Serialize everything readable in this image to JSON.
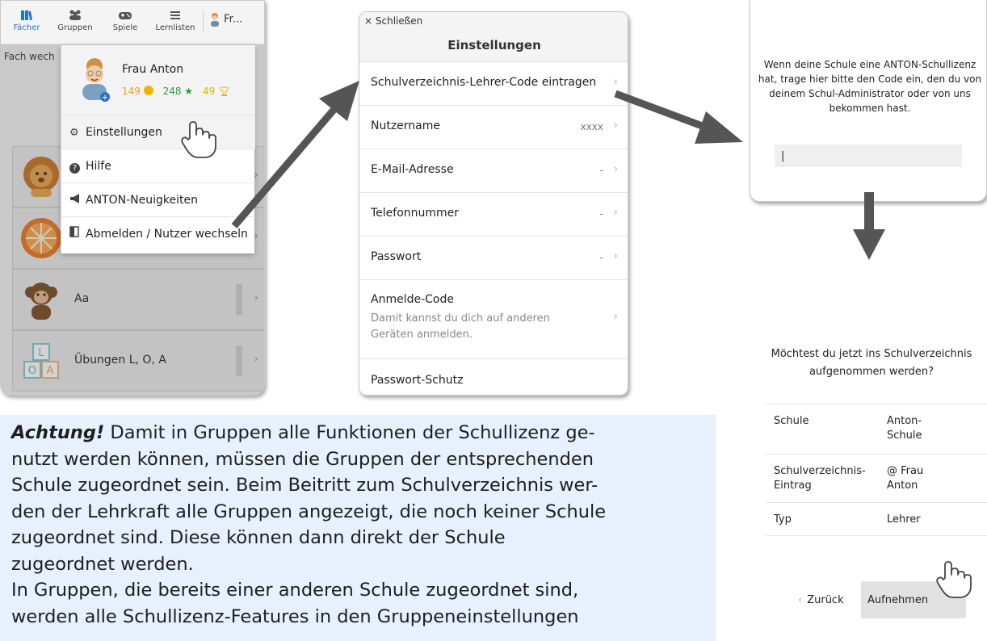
{
  "panel1": {
    "tabs": [
      {
        "label": "Fächer",
        "icon": "books-icon"
      },
      {
        "label": "Gruppen",
        "icon": "group-icon"
      },
      {
        "label": "Spiele",
        "icon": "gamepad-icon"
      },
      {
        "label": "Lernlisten",
        "icon": "list-icon"
      }
    ],
    "user_tab": "Fr...",
    "behind_text": "Fach wech",
    "rows": [
      {
        "label": "Aa"
      },
      {
        "label": "Übungen L, O, A"
      }
    ],
    "menu": {
      "name": "Frau Anton",
      "coins": "149",
      "stars": "248",
      "trophies": "49",
      "items": [
        "Einstellungen",
        "Hilfe",
        "ANTON-Neuigkeiten",
        "Abmelden / Nutzer wechseln"
      ]
    }
  },
  "panel2": {
    "close": "× Schließen",
    "title": "Einstellungen",
    "rows": [
      {
        "label": "Schulverzeichnis-Lehrer-Code eintragen",
        "value": ""
      },
      {
        "label": "Nutzername",
        "value": "xxxx"
      },
      {
        "label": "E-Mail-Adresse",
        "value": "-"
      },
      {
        "label": "Telefonnummer",
        "value": "-"
      },
      {
        "label": "Passwort",
        "value": "-"
      }
    ],
    "login_code": {
      "label": "Anmelde-Code",
      "desc": "Damit kannst du dich auf anderen Geräten anmelden."
    },
    "last_row": "Passwort-Schutz"
  },
  "panel3": {
    "text": "Wenn deine Schule eine ANTON-Schullizenz hat, trage hier bitte den Code ein, den du von deinem Schul-Administrator oder von uns bekommen hast.",
    "input_value": "|"
  },
  "panel4": {
    "question": "Möchtest du jetzt ins Schulverzeichnis aufgenommen werden?",
    "table": [
      {
        "key": "Schule",
        "value": "Anton-Schule"
      },
      {
        "key": "Schulverzeichnis-Eintrag",
        "value": "@ Frau Anton"
      },
      {
        "key": "Typ",
        "value": "Lehrer"
      }
    ],
    "back": "Zurück",
    "accept": "Aufnehmen"
  },
  "note": {
    "lead": "Achtung!",
    "line1": " Damit in Gruppen alle Funktionen der Schullizenz ge-",
    "line2": "nutzt werden können, müssen die Gruppen der entsprechenden",
    "line3": "Schule zugeordnet sein. Beim Beitritt zum Schulverzeichnis wer-",
    "line4": "den der Lehrkraft alle Gruppen angezeigt, die noch keiner Schule",
    "line5": "zugeordnet sind. Diese können dann direkt der Schule",
    "line6": "zugeordnet werden.",
    "line7": "In Gruppen, die bereits einer anderen Schule zugeordnet sind,",
    "line8": "werden alle Schullizenz-Features in den Gruppeneinstellungen"
  },
  "colors": {
    "accent_blue": "#2c73c7",
    "coin": "#f0a500",
    "star": "#2e9b3a",
    "trophy": "#e0b400",
    "note_bg": "#e6f1fd",
    "arrow": "#555555"
  }
}
